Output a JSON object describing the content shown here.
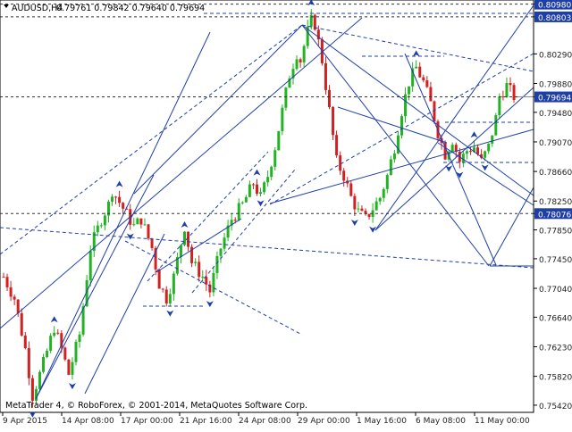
{
  "header": {
    "symbol": "AUDUSD,H4",
    "ohlc": "0.79761 0.79842 0.79640 0.79694"
  },
  "watermark": "MetaTrader 4, © RoboForex, © 2001-2014, MetaQuotes Software Corp.",
  "colors": {
    "up": "#22b322",
    "down": "#d42020",
    "line": "#1f3fa8",
    "label_bg": "#1f3fa8",
    "grid_text": "#222222"
  },
  "chart_data": {
    "type": "candlestick",
    "title": "AUDUSD,H4",
    "xlabel": "",
    "ylabel": "",
    "ylim": [
      0.7537,
      0.81
    ],
    "y_ticks": [
      "0.80980",
      "0.80803",
      "0.80290",
      "0.79880",
      "0.79694",
      "0.79480",
      "0.79070",
      "0.78660",
      "0.78250",
      "0.78076",
      "0.77850",
      "0.77450",
      "0.77040",
      "0.76640",
      "0.76230",
      "0.75820",
      "0.75420"
    ],
    "highlighted_levels": [
      "0.80980",
      "0.80803",
      "0.79694",
      "0.78076"
    ],
    "x_labels": [
      "9 Apr 2015",
      "14 Apr 08:00",
      "17 Apr 00:00",
      "21 Apr 16:00",
      "24 Apr 08:00",
      "29 Apr 00:00",
      "1 May 16:00",
      "6 May 08:00",
      "11 May 00:00"
    ],
    "grid": false,
    "legend": "none",
    "anchors": [
      [
        0,
        0.772
      ],
      [
        3,
        0.769
      ],
      [
        6,
        0.762
      ],
      [
        8,
        0.7555
      ],
      [
        11,
        0.76
      ],
      [
        14,
        0.765
      ],
      [
        16,
        0.762
      ],
      [
        18,
        0.7585
      ],
      [
        21,
        0.764
      ],
      [
        24,
        0.776
      ],
      [
        27,
        0.78
      ],
      [
        29,
        0.782
      ],
      [
        30,
        0.784
      ],
      [
        33,
        0.7815
      ],
      [
        36,
        0.779
      ],
      [
        38,
        0.78
      ],
      [
        41,
        0.776
      ],
      [
        43,
        0.771
      ],
      [
        45,
        0.769
      ],
      [
        47,
        0.772
      ],
      [
        50,
        0.779
      ],
      [
        52,
        0.774
      ],
      [
        55,
        0.772
      ],
      [
        57,
        0.77
      ],
      [
        60,
        0.776
      ],
      [
        63,
        0.78
      ],
      [
        66,
        0.782
      ],
      [
        69,
        0.785
      ],
      [
        71,
        0.783
      ],
      [
        73,
        0.786
      ],
      [
        75,
        0.79
      ],
      [
        77,
        0.795
      ],
      [
        79,
        0.8
      ],
      [
        81,
        0.803
      ],
      [
        82,
        0.802
      ],
      [
        84,
        0.806
      ],
      [
        85,
        0.8075
      ],
      [
        86,
        0.807
      ],
      [
        88,
        0.802
      ],
      [
        90,
        0.795
      ],
      [
        92,
        0.788
      ],
      [
        94,
        0.786
      ],
      [
        96,
        0.783
      ],
      [
        98,
        0.781
      ],
      [
        100,
        0.78
      ],
      [
        102,
        0.7815
      ],
      [
        104,
        0.783
      ],
      [
        106,
        0.786
      ],
      [
        108,
        0.79
      ],
      [
        110,
        0.795
      ],
      [
        112,
        0.799
      ],
      [
        114,
        0.801
      ],
      [
        116,
        0.799
      ],
      [
        118,
        0.796
      ],
      [
        120,
        0.792
      ],
      [
        122,
        0.789
      ],
      [
        124,
        0.791
      ],
      [
        126,
        0.788
      ],
      [
        128,
        0.7895
      ],
      [
        130,
        0.79
      ],
      [
        132,
        0.788
      ],
      [
        134,
        0.79
      ],
      [
        136,
        0.794
      ],
      [
        137,
        0.797
      ],
      [
        139,
        0.7985
      ],
      [
        141,
        0.797
      ]
    ],
    "last_price": 0.79694
  }
}
